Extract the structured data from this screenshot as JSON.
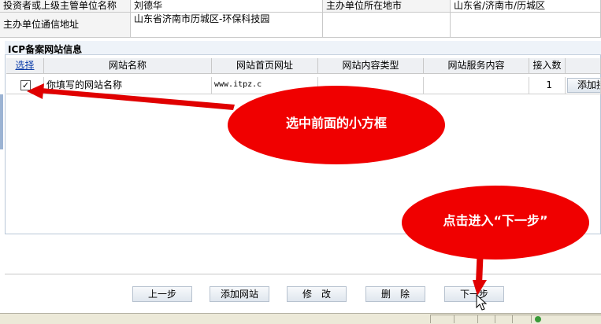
{
  "top_form": {
    "investor_label": "投资者或上级主管单位名称",
    "investor_value": "刘德华",
    "city_label": "主办单位所在地市",
    "city_value": "山东省/济南市/历城区",
    "address_label": "主办单位通信地址",
    "address_value": "山东省济南市历城区-环保科技园"
  },
  "icp_section": {
    "title": "ICP备案网站信息",
    "columns": [
      "选择",
      "网站名称",
      "网站首页网址",
      "网站内容类型",
      "网站服务内容",
      "接入数"
    ],
    "row": {
      "checked": true,
      "check_glyph": "✓",
      "name": "你填写的网站名称",
      "url": "www.itpz.c",
      "content_type": "",
      "service": "",
      "access_count": "1",
      "action_label": "添加接"
    }
  },
  "buttons": {
    "prev": "上一步",
    "add_site": "添加网站",
    "modify": "修　改",
    "delete": "删　除",
    "next": "下一步"
  },
  "annotations": {
    "select_hint": "选中前面的小方框",
    "next_hint": "点击进入“下一步”",
    "color": "#f00000"
  }
}
